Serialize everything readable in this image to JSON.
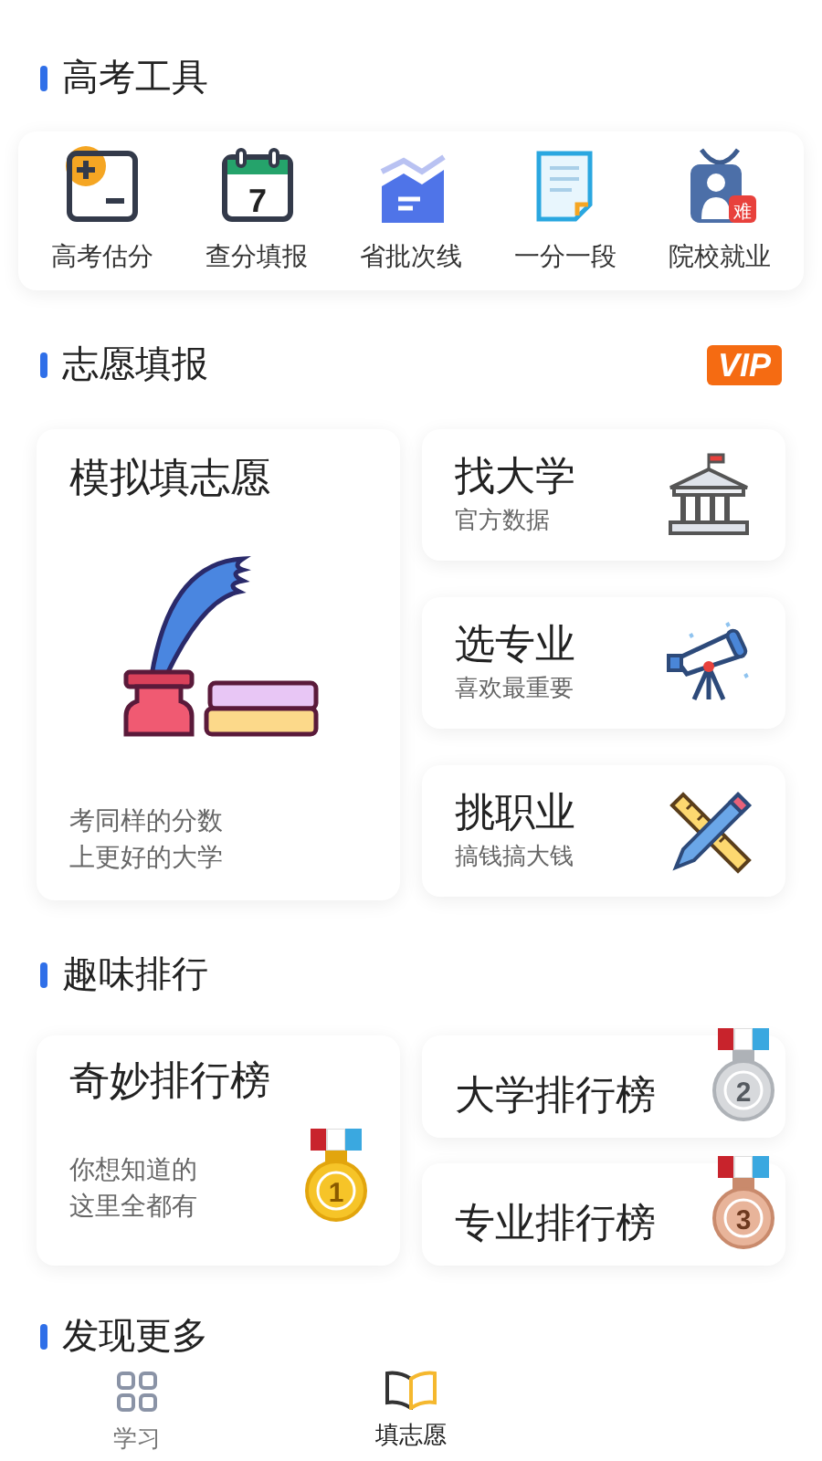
{
  "tools_section": {
    "title": "高考工具",
    "items": [
      {
        "label": "高考估分",
        "kind": "calculator"
      },
      {
        "label": "查分填报",
        "kind": "calendar",
        "icon_text": "7"
      },
      {
        "label": "省批次线",
        "kind": "chart"
      },
      {
        "label": "一分一段",
        "kind": "document"
      },
      {
        "label": "院校就业",
        "kind": "person",
        "icon_text": "难"
      }
    ]
  },
  "volunteer_section": {
    "title": "志愿填报",
    "badge": "VIP",
    "main_card": {
      "title": "模拟填志愿",
      "lines": [
        "考同样的分数",
        "上更好的大学"
      ]
    },
    "side_cards": [
      {
        "title": "找大学",
        "subtitle": "官方数据",
        "kind": "building"
      },
      {
        "title": "选专业",
        "subtitle": "喜欢最重要",
        "kind": "telescope"
      },
      {
        "title": "挑职业",
        "subtitle": "搞钱搞大钱",
        "kind": "tools"
      }
    ]
  },
  "ranking_section": {
    "title": "趣味排行",
    "main_card": {
      "title": "奇妙排行榜",
      "lines": [
        "你想知道的",
        "这里全都有"
      ],
      "medal": "1"
    },
    "side_cards": [
      {
        "title": "大学排行榜",
        "medal": "2"
      },
      {
        "title": "专业排行榜",
        "medal": "3"
      }
    ]
  },
  "discover_section": {
    "title": "发现更多"
  },
  "nav": [
    {
      "label": "学习",
      "kind": "grid",
      "selected": false
    },
    {
      "label": "填志愿",
      "kind": "book",
      "selected": true
    }
  ]
}
